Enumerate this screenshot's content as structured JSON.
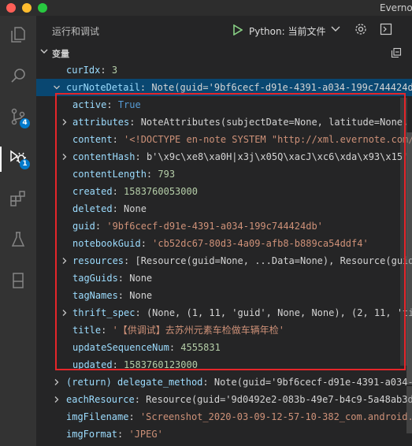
{
  "window": {
    "title": "Everno"
  },
  "activity_bar": {
    "source_control_badge": "4",
    "debug_badge": "1"
  },
  "run_panel": {
    "title": "运行和调试",
    "config_label": "Python: 当前文件"
  },
  "variables": {
    "section_title": "变量",
    "rows": [
      {
        "indent": 1,
        "twistie": "",
        "key": "curIdx",
        "value": "3",
        "vtype": "n"
      },
      {
        "indent": 1,
        "twistie": "open",
        "key": "curNoteDetail",
        "value": "Note(guid='9bf6cecf-d91e-4391-a034-199c744424db',...",
        "vtype": "v",
        "selected": true
      },
      {
        "indent": 2,
        "twistie": "",
        "key": "active",
        "value": "True",
        "vtype": "b"
      },
      {
        "indent": 2,
        "twistie": "closed",
        "key": "attributes",
        "value": "NoteAttributes(subjectDate=None, latitude=None, lon...",
        "vtype": "v"
      },
      {
        "indent": 2,
        "twistie": "",
        "key": "content",
        "value": "'<!DOCTYPE en-note SYSTEM \"http://xml.evernote.com/pub...",
        "vtype": "s"
      },
      {
        "indent": 2,
        "twistie": "closed",
        "key": "contentHash",
        "value": "b'\\x9c\\xe8\\xa0H|x3j\\x05Q\\xacJ\\xc6\\xda\\x93\\x15'",
        "vtype": "v"
      },
      {
        "indent": 2,
        "twistie": "",
        "key": "contentLength",
        "value": "793",
        "vtype": "n"
      },
      {
        "indent": 2,
        "twistie": "",
        "key": "created",
        "value": "1583760053000",
        "vtype": "n"
      },
      {
        "indent": 2,
        "twistie": "",
        "key": "deleted",
        "value": "None",
        "vtype": "v"
      },
      {
        "indent": 2,
        "twistie": "",
        "key": "guid",
        "value": "'9bf6cecf-d91e-4391-a034-199c744424db'",
        "vtype": "s"
      },
      {
        "indent": 2,
        "twistie": "",
        "key": "notebookGuid",
        "value": "'cb52dc67-80d3-4a09-afb8-b889ca54ddf4'",
        "vtype": "s"
      },
      {
        "indent": 2,
        "twistie": "closed",
        "key": "resources",
        "value": "[Resource(guid=None, ...Data=None), Resource(guid=No...",
        "vtype": "v"
      },
      {
        "indent": 2,
        "twistie": "",
        "key": "tagGuids",
        "value": "None",
        "vtype": "v"
      },
      {
        "indent": 2,
        "twistie": "",
        "key": "tagNames",
        "value": "None",
        "vtype": "v"
      },
      {
        "indent": 2,
        "twistie": "closed",
        "key": "thrift_spec",
        "value": "(None, (1, 11, 'guid', None, None), (2, 11, 'title...",
        "vtype": "v"
      },
      {
        "indent": 2,
        "twistie": "",
        "key": "title",
        "value": "'【供调试】去苏州元素车检做车辆年检'",
        "vtype": "s"
      },
      {
        "indent": 2,
        "twistie": "",
        "key": "updateSequenceNum",
        "value": "4555831",
        "vtype": "n"
      },
      {
        "indent": 2,
        "twistie": "",
        "key": "updated",
        "value": "1583760123000",
        "vtype": "n"
      },
      {
        "indent": 1,
        "twistie": "closed",
        "key": "(return) delegate_method",
        "value": "Note(guid='9bf6cecf-d91e-4391-a034-199...",
        "vtype": "v"
      },
      {
        "indent": 1,
        "twistie": "closed",
        "key": "eachResource",
        "value": "Resource(guid='9d0492e2-083b-49e7-b4c9-5a48ab3d596...",
        "vtype": "v"
      },
      {
        "indent": 1,
        "twistie": "",
        "key": "imgFilename",
        "value": "'Screenshot_2020-03-09-12-57-10-382_com.android.mms'",
        "vtype": "s"
      },
      {
        "indent": 1,
        "twistie": "",
        "key": "imgFormat",
        "value": "'JPEG'",
        "vtype": "s"
      }
    ]
  }
}
